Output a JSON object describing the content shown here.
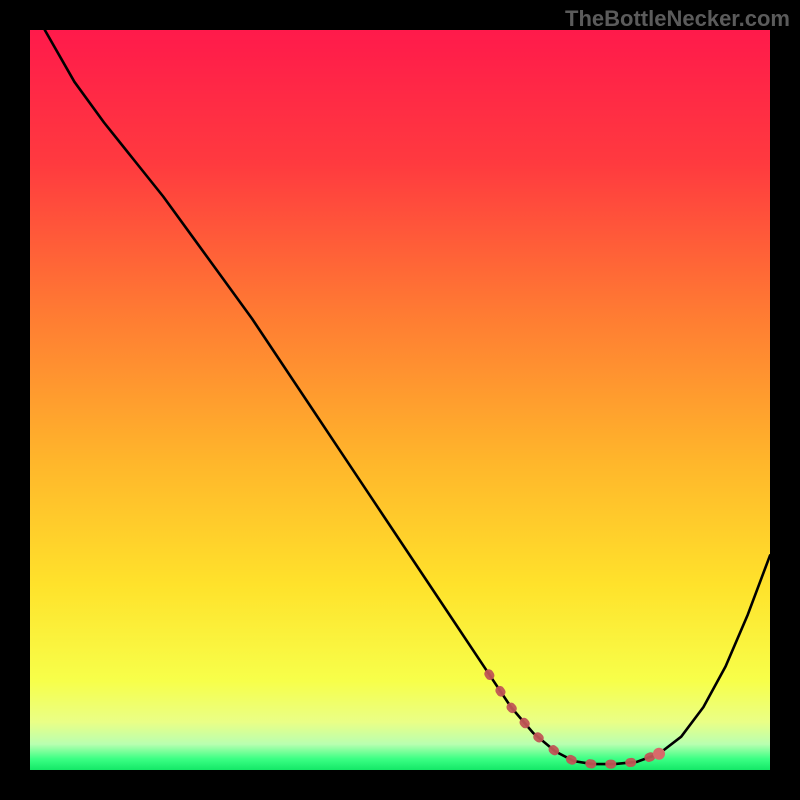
{
  "watermark": "TheBottleNecker.com",
  "colors": {
    "gradient_stops": [
      {
        "offset": 0.0,
        "color": "#ff1a4b"
      },
      {
        "offset": 0.18,
        "color": "#ff3a3f"
      },
      {
        "offset": 0.38,
        "color": "#ff7a33"
      },
      {
        "offset": 0.58,
        "color": "#ffb52b"
      },
      {
        "offset": 0.75,
        "color": "#ffe22b"
      },
      {
        "offset": 0.88,
        "color": "#f7ff4a"
      },
      {
        "offset": 0.935,
        "color": "#eaff86"
      },
      {
        "offset": 0.965,
        "color": "#b9ffb0"
      },
      {
        "offset": 0.985,
        "color": "#3bff84"
      },
      {
        "offset": 1.0,
        "color": "#14e867"
      }
    ],
    "curve_stroke": "#000000",
    "marker_stroke": "#c05555",
    "marker_fill": "#d86a6a"
  },
  "chart_data": {
    "type": "line",
    "title": "",
    "xlabel": "",
    "ylabel": "",
    "xlim": [
      0,
      100
    ],
    "ylim": [
      0,
      100
    ],
    "series": [
      {
        "name": "bottleneck-curve",
        "x": [
          2,
          6,
          10,
          14,
          18,
          22,
          26,
          30,
          34,
          38,
          42,
          46,
          50,
          54,
          58,
          62,
          65,
          68,
          71,
          73.5,
          76,
          79,
          82,
          85,
          88,
          91,
          94,
          97,
          100
        ],
        "y": [
          100,
          93,
          87.5,
          82.5,
          77.5,
          72,
          66.5,
          61,
          55,
          49,
          43,
          37,
          31,
          25,
          19,
          13,
          8.5,
          5,
          2.5,
          1.2,
          0.8,
          0.8,
          1.1,
          2.2,
          4.5,
          8.5,
          14,
          21,
          29
        ]
      }
    ],
    "highlight": {
      "name": "optimal-region",
      "x": [
        62,
        65,
        68,
        71,
        73.5,
        76,
        79,
        82,
        85
      ],
      "y": [
        13,
        8.5,
        5,
        2.5,
        1.2,
        0.8,
        0.8,
        1.1,
        2.2
      ],
      "point_visible": [
        false,
        false,
        false,
        false,
        false,
        false,
        false,
        false,
        true
      ]
    }
  }
}
